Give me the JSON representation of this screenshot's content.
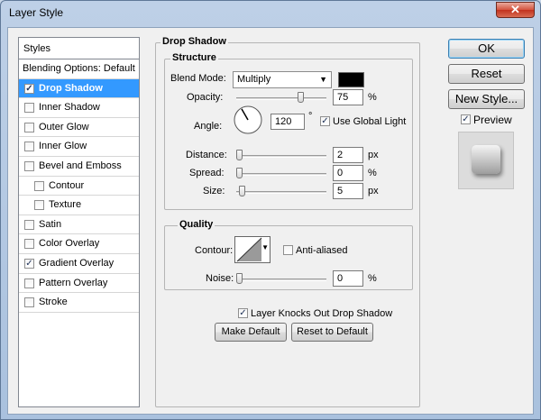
{
  "window": {
    "title": "Layer Style",
    "close_glyph": "✕"
  },
  "styles_list": {
    "header": "Styles",
    "items": [
      {
        "label": "Blending Options: Default",
        "checkbox": false,
        "checked": false
      },
      {
        "label": "Drop Shadow",
        "checkbox": true,
        "checked": true,
        "selected": true
      },
      {
        "label": "Inner Shadow",
        "checkbox": true,
        "checked": false
      },
      {
        "label": "Outer Glow",
        "checkbox": true,
        "checked": false
      },
      {
        "label": "Inner Glow",
        "checkbox": true,
        "checked": false
      },
      {
        "label": "Bevel and Emboss",
        "checkbox": true,
        "checked": false
      },
      {
        "label": "Contour",
        "checkbox": true,
        "checked": false,
        "sub": true
      },
      {
        "label": "Texture",
        "checkbox": true,
        "checked": false,
        "sub": true
      },
      {
        "label": "Satin",
        "checkbox": true,
        "checked": false
      },
      {
        "label": "Color Overlay",
        "checkbox": true,
        "checked": false
      },
      {
        "label": "Gradient Overlay",
        "checkbox": true,
        "checked": true
      },
      {
        "label": "Pattern Overlay",
        "checkbox": true,
        "checked": false
      },
      {
        "label": "Stroke",
        "checkbox": true,
        "checked": false
      }
    ]
  },
  "drop_shadow": {
    "title": "Drop Shadow",
    "structure": {
      "title": "Structure",
      "blend_mode_label": "Blend Mode:",
      "blend_mode_value": "Multiply",
      "blend_color": "#000000",
      "opacity_label": "Opacity:",
      "opacity_value": "75",
      "opacity_unit": "%",
      "opacity_level": 0.75,
      "angle_label": "Angle:",
      "angle_value": "120",
      "angle_unit": "°",
      "use_global_light_label": "Use Global Light",
      "use_global_light_checked": true,
      "distance_label": "Distance:",
      "distance_value": "2",
      "distance_unit": "px",
      "spread_label": "Spread:",
      "spread_value": "0",
      "spread_unit": "%",
      "size_label": "Size:",
      "size_value": "5",
      "size_unit": "px"
    },
    "quality": {
      "title": "Quality",
      "contour_label": "Contour:",
      "anti_aliased_label": "Anti-aliased",
      "anti_aliased_checked": false,
      "noise_label": "Noise:",
      "noise_value": "0",
      "noise_unit": "%"
    },
    "layer_knocks_out_label": "Layer Knocks Out Drop Shadow",
    "layer_knocks_out_checked": true,
    "make_default_label": "Make Default",
    "reset_default_label": "Reset to Default"
  },
  "actions": {
    "ok_label": "OK",
    "reset_label": "Reset",
    "new_style_label": "New Style...",
    "preview_label": "Preview",
    "preview_checked": true
  },
  "colors": {
    "selection": "#3399ff",
    "window_chrome": "#bed0e7"
  }
}
